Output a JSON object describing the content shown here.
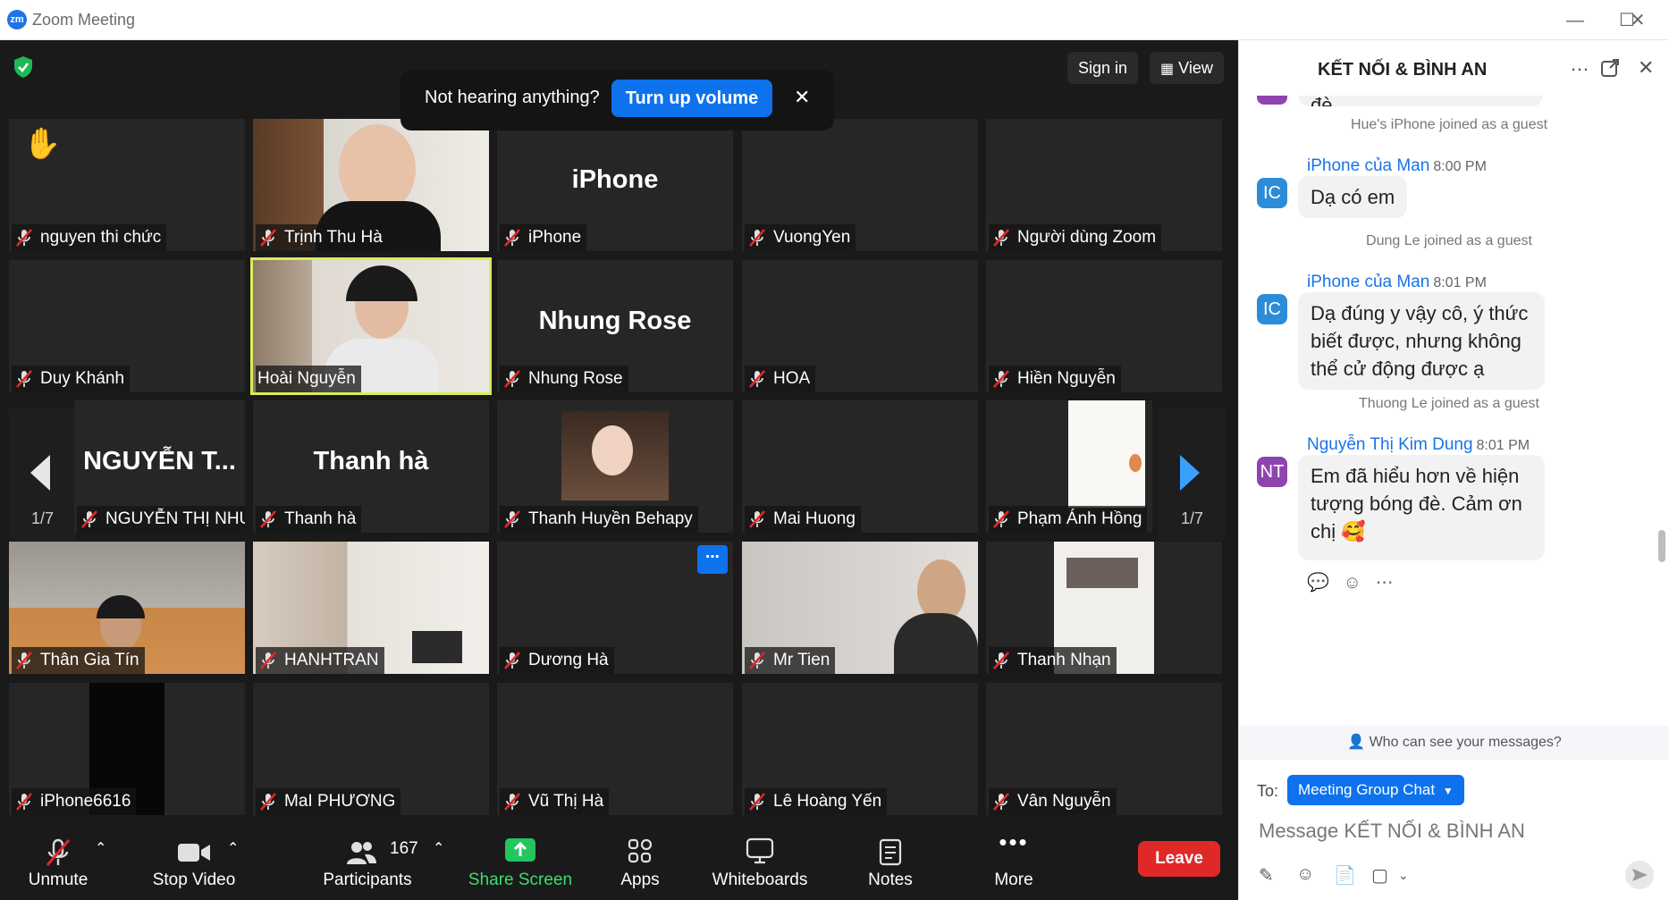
{
  "window": {
    "title": "Zoom Meeting",
    "logo": "zm"
  },
  "top_bar": {
    "sign_in": "Sign in",
    "view": "View"
  },
  "audio_banner": {
    "text": "Not hearing anything?",
    "button": "Turn up volume",
    "close": "✕"
  },
  "pager": {
    "left": "1/7",
    "right": "1/7"
  },
  "tiles": [
    {
      "name": "nguyen thi chức",
      "big": ""
    },
    {
      "name": "Trịnh Thu Hà",
      "big": ""
    },
    {
      "name": "iPhone",
      "big": "iPhone"
    },
    {
      "name": "VuongYen",
      "big": ""
    },
    {
      "name": "Người dùng Zoom",
      "big": ""
    },
    {
      "name": "Duy Khánh",
      "big": ""
    },
    {
      "name": "Hoài Nguyễn",
      "big": ""
    },
    {
      "name": "Nhung Rose",
      "big": "Nhung Rose"
    },
    {
      "name": "HOA",
      "big": ""
    },
    {
      "name": "Hiền Nguyễn",
      "big": ""
    },
    {
      "name": "NGUYỄN THỊ NHƯ TR...",
      "big": "NGUYỄN T..."
    },
    {
      "name": "Thanh hà",
      "big": "Thanh hà"
    },
    {
      "name": "Thanh Huyền Behapy",
      "big": ""
    },
    {
      "name": "Mai Huong",
      "big": ""
    },
    {
      "name": "Phạm Ánh Hồng",
      "big": ""
    },
    {
      "name": "Thân Gia Tín",
      "big": ""
    },
    {
      "name": "HANHTRAN",
      "big": ""
    },
    {
      "name": "Dương Hà",
      "big": ""
    },
    {
      "name": "Mr Tien",
      "big": ""
    },
    {
      "name": "Thanh Nhạn",
      "big": ""
    },
    {
      "name": "iPhone6616",
      "big": ""
    },
    {
      "name": "MaI PHƯƠNG",
      "big": ""
    },
    {
      "name": "Vũ Thị Hà",
      "big": ""
    },
    {
      "name": "Lê Hoàng Yến",
      "big": ""
    },
    {
      "name": "Vân Nguyễn",
      "big": ""
    }
  ],
  "toolbar": {
    "unmute": "Unmute",
    "stop_video": "Stop Video",
    "participants": "Participants",
    "participant_count": "167",
    "share_screen": "Share Screen",
    "apps": "Apps",
    "whiteboards": "Whiteboards",
    "notes": "Notes",
    "more": "More",
    "leave": "Leave"
  },
  "chat": {
    "title": "KẾT NỐI & BÌNH AN",
    "cut_text": "Em thỉnh thoảng bị bóng đè",
    "messages": [
      {
        "system": "Hue's iPhone joined as a guest"
      },
      {
        "avatar": "IC",
        "sender": "iPhone của Man",
        "time": "8:00 PM",
        "text": "Dạ có em"
      },
      {
        "system": "Dung Le joined as a guest"
      },
      {
        "avatar": "IC",
        "sender": "iPhone của Man",
        "time": "8:01 PM",
        "text": "Dạ đúng y vậy cô, ý thức biết được, nhưng không thể cử động được ạ"
      },
      {
        "system": "Thuong Le joined as a guest"
      },
      {
        "avatar": "NT",
        "sender": "Nguyễn Thị Kim Dung",
        "time": "8:01 PM",
        "text": "Em đã hiểu hơn về hiện tượng bóng đè. Cảm ơn chị",
        "emoji": "🥰"
      }
    ],
    "who_can_see": "Who can see your messages?",
    "to_label": "To:",
    "to_value": "Meeting Group Chat",
    "input_placeholder": "Message  KẾT NỐI & BÌNH AN"
  },
  "colors": {
    "accent": "#0e72ed",
    "leave": "#e02828",
    "active_speaker": "#d8ee5a",
    "avatar_ic": "#2d8cd8",
    "avatar_nt": "#8e44ad"
  }
}
